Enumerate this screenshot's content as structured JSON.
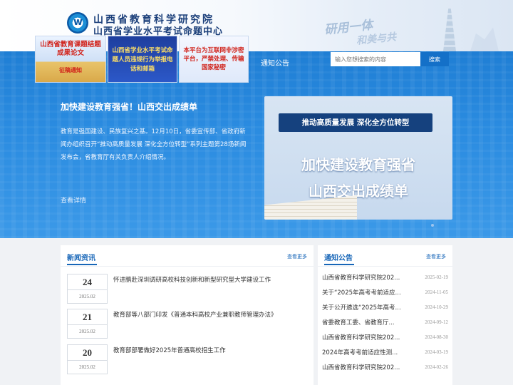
{
  "header": {
    "org_name_1": "山西省教育科学研究院",
    "org_name_2": "山西省学业水平考试命题中心",
    "slogan_line1": "研用一体",
    "slogan_line2": "和美与共"
  },
  "banners": [
    {
      "text": "山西省教育课题结题成果论文",
      "sub": "征稿通知"
    },
    {
      "text": "山西省学业水平考试命题人员违规行为举报电话和邮箱"
    },
    {
      "text": "本平台为互联网非涉密平台，严禁处理、传输国家秘密"
    }
  ],
  "nav": {
    "notice": "通知公告"
  },
  "search": {
    "placeholder": "输入您想搜索的内容",
    "button": "搜索"
  },
  "lead": {
    "title": "加快建设教育强省！山西交出成绩单",
    "body": "教育是强国建设、民族复兴之基。12月10日，省委宣传部、省政府新闻办组织召开“推动高质量发展 深化全方位转型”系列主题第28场新闻发布会，省教育厅有关负责人介绍情况。",
    "more": "查看详情"
  },
  "feature": {
    "banner": "推动高质量发展 深化全方位转型",
    "line1": "加快建设教育强省",
    "line2": "山西交出成绩单"
  },
  "news": {
    "title": "新闻资讯",
    "more": "查看更多",
    "items": [
      {
        "day": "24",
        "ym": "2025.02",
        "title": "怀进鹏赴深圳调研高校科技创新和新型研究型大学建设工作"
      },
      {
        "day": "21",
        "ym": "2025.02",
        "title": "教育部等八部门印发《普通本科高校产业兼职教师管理办法》"
      },
      {
        "day": "20",
        "ym": "2025.02",
        "title": "教育部部署做好2025年普通高校招生工作"
      }
    ]
  },
  "notices": {
    "title": "通知公告",
    "more": "查看更多",
    "items": [
      {
        "title": "山西省教育科学研究院202...",
        "date": "2025-02-19"
      },
      {
        "title": "关于“2025年高考考前适应...",
        "date": "2024-11-05"
      },
      {
        "title": "关于公开遴选“2025年高考...",
        "date": "2024-10-29"
      },
      {
        "title": "省委教育工委、省教育厅...",
        "date": "2024-09-12"
      },
      {
        "title": "山西省教育科学研究院202...",
        "date": "2024-08-30"
      },
      {
        "title": "2024年高考考前适应性测...",
        "date": "2024-03-19"
      },
      {
        "title": "山西省教育科学研究院202...",
        "date": "2024-02-26"
      }
    ]
  },
  "colors": {
    "brand_blue": "#1f7ed4",
    "accent_red": "#d1221a",
    "link_blue": "#1766b8"
  },
  "icons": {
    "logo": "institute-logo-icon"
  }
}
